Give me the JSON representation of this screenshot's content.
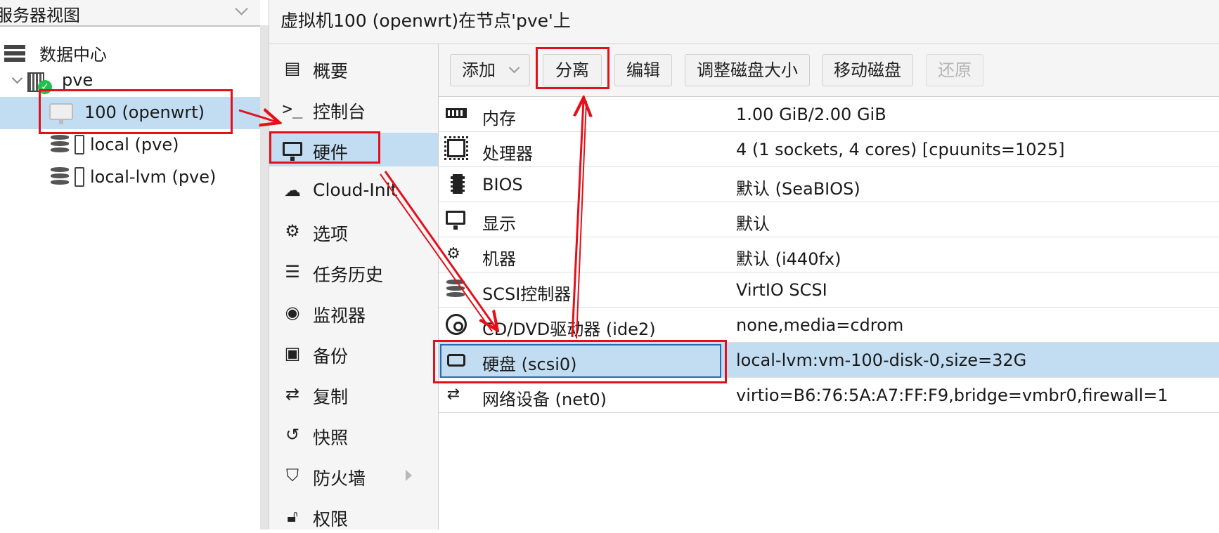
{
  "tree": {
    "title": "服务器视图",
    "items": [
      {
        "label": "数据中心",
        "icon": "datacenter-icon"
      },
      {
        "label": "pve",
        "icon": "node-icon",
        "status": "online"
      },
      {
        "label": "100 (openwrt)",
        "icon": "vm-icon",
        "selected": true
      },
      {
        "label": "local (pve)",
        "icon": "storage-icon"
      },
      {
        "label": "local-lvm (pve)",
        "icon": "storage-icon"
      }
    ]
  },
  "main": {
    "title": "虚拟机100 (openwrt)在节点'pve'上"
  },
  "menu": {
    "items": [
      {
        "label": "概要",
        "icon": "book-icon"
      },
      {
        "label": "控制台",
        "icon": "terminal-icon"
      },
      {
        "label": "硬件",
        "icon": "monitor-icon",
        "selected": true
      },
      {
        "label": "Cloud-Init",
        "icon": "cloud-icon"
      },
      {
        "label": "选项",
        "icon": "gear-icon"
      },
      {
        "label": "任务历史",
        "icon": "list-icon"
      },
      {
        "label": "监视器",
        "icon": "eye-icon"
      },
      {
        "label": "备份",
        "icon": "floppy-icon"
      },
      {
        "label": "复制",
        "icon": "retweet-icon"
      },
      {
        "label": "快照",
        "icon": "history-icon"
      },
      {
        "label": "防火墙",
        "icon": "shield-icon"
      },
      {
        "label": "权限",
        "icon": "unlock-icon"
      }
    ]
  },
  "toolbar": {
    "add": "添加",
    "detach": "分离",
    "edit": "编辑",
    "resize": "调整磁盘大小",
    "move": "移动磁盘",
    "revert": "还原"
  },
  "hardware": {
    "rows": [
      {
        "name": "内存",
        "value": "1.00 GiB/2.00 GiB",
        "icon": "memory-icon"
      },
      {
        "name": "处理器",
        "value": "4 (1 sockets, 4 cores) [cpuunits=1025]",
        "icon": "cpu-icon"
      },
      {
        "name": "BIOS",
        "value": "默认 (SeaBIOS)",
        "icon": "microchip-icon"
      },
      {
        "name": "显示",
        "value": "默认",
        "icon": "monitor-icon"
      },
      {
        "name": "机器",
        "value": "默认 (i440fx)",
        "icon": "cogs-icon"
      },
      {
        "name": "SCSI控制器",
        "value": "VirtIO SCSI",
        "icon": "database-icon"
      },
      {
        "name": "CD/DVD驱动器 (ide2)",
        "value": "none,media=cdrom",
        "icon": "cdrom-icon"
      },
      {
        "name": "硬盘 (scsi0)",
        "value": "local-lvm:vm-100-disk-0,size=32G",
        "icon": "hdd-icon",
        "selected": true
      },
      {
        "name": "网络设备 (net0)",
        "value": "virtio=B6:76:5A:A7:FF:F9,bridge=vmbr0,firewall=1",
        "icon": "exchange-icon"
      }
    ]
  },
  "colors": {
    "selection": "#c2ddf2",
    "annotation": "#e3101a",
    "panel": "#f5f5f5"
  }
}
